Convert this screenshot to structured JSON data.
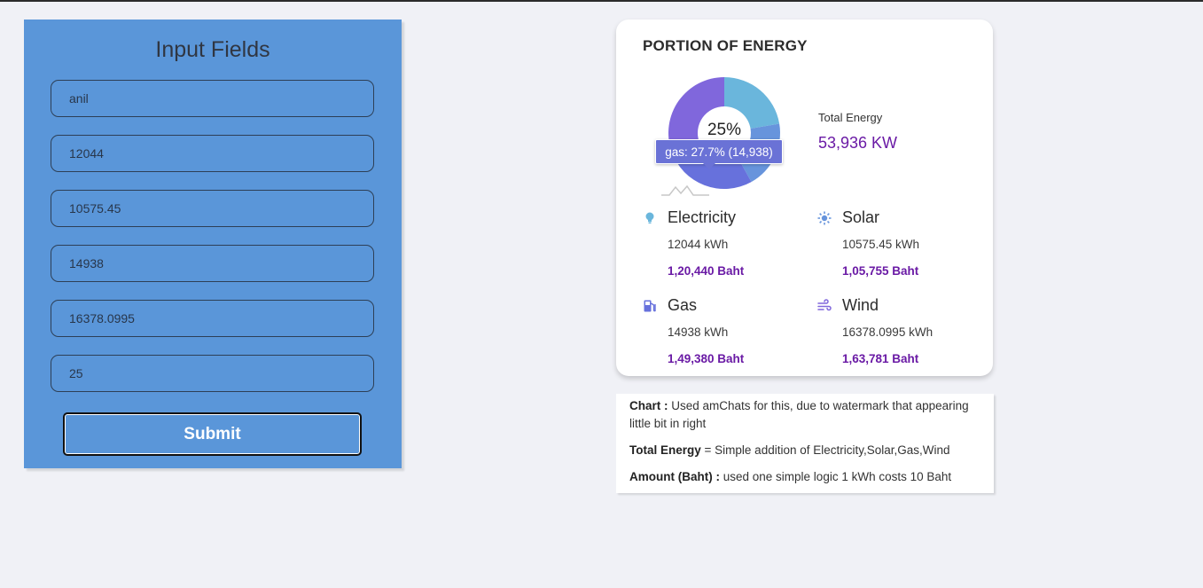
{
  "form": {
    "title": "Input Fields",
    "fields": [
      {
        "value": "anil"
      },
      {
        "value": "12044"
      },
      {
        "value": "10575.45"
      },
      {
        "value": "14938"
      },
      {
        "value": "16378.0995"
      },
      {
        "value": "25"
      }
    ],
    "submit_label": "Submit"
  },
  "card": {
    "title": "PORTION OF ENERGY",
    "donut_center": "25%",
    "tooltip": "gas: 27.7% (14,938)",
    "total_label": "Total Energy",
    "total_value": "53,936 KW",
    "sources": [
      {
        "name": "Electricity",
        "kwh": "12044 kWh",
        "baht": "1,20,440 Baht",
        "icon": "lightbulb-icon"
      },
      {
        "name": "Solar",
        "kwh": "10575.45 kWh",
        "baht": "1,05,755 Baht",
        "icon": "sun-icon"
      },
      {
        "name": "Gas",
        "kwh": "14938 kWh",
        "baht": "1,49,380 Baht",
        "icon": "gas-pump-icon"
      },
      {
        "name": "Wind",
        "kwh": "16378.0995 kWh",
        "baht": "1,63,781 Baht",
        "icon": "wind-icon"
      }
    ],
    "colors": {
      "electricity": "#6ab6dc",
      "solar": "#6794dc",
      "gas": "#6771dc",
      "wind": "#8067dc",
      "accent": "#6a1aa5"
    }
  },
  "chart_data": {
    "type": "pie",
    "categories": [
      "electricity",
      "solar",
      "gas",
      "wind"
    ],
    "values": [
      12044,
      10575.45,
      14938,
      16378.0995
    ],
    "inner_radius_label": "25%"
  },
  "notes": {
    "chart_label": "Chart :",
    "chart_text": "Used amChats for this, due to watermark that appearing little bit in right",
    "total_label": "Total Energy",
    "total_text": "= Simple addition of Electricity,Solar,Gas,Wind",
    "amount_label": "Amount (Baht) :",
    "amount_text": "used one simple logic 1 kWh costs 10 Baht"
  }
}
